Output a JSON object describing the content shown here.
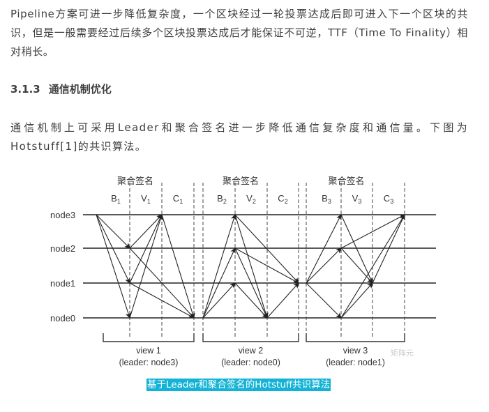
{
  "paragraph1": "Pipeline方案可进一步降低复杂度，一个区块经过一轮投票达成后即可进入下一个区块的共识，但是一般需要经过后续多个区块投票达成后才能保证不可逆，TTF（Time To Finality）相对稍长。",
  "heading": {
    "number": "3.1.3",
    "title": "通信机制优化"
  },
  "paragraph2": "通信机制上可采用Leader和聚合签名进一步降低通信复杂度和通信量。下图为Hotstuff[1]的共识算法。",
  "diagram": {
    "nodes": [
      "node0",
      "node1",
      "node2",
      "node3"
    ],
    "views": [
      {
        "label": "view 1",
        "leader": "(leader: node3)",
        "agg": "聚合签名",
        "phases": [
          [
            "B",
            "1"
          ],
          [
            "V",
            "1"
          ],
          [
            "C",
            "1"
          ]
        ],
        "edges": [
          [
            0,
            3,
            1,
            2
          ],
          [
            0,
            3,
            1,
            1
          ],
          [
            0,
            3,
            1,
            0
          ],
          [
            1,
            2,
            2,
            3
          ],
          [
            1,
            1,
            2,
            3
          ],
          [
            1,
            0,
            2,
            3
          ],
          [
            2,
            3,
            3,
            0
          ],
          [
            1,
            2,
            3,
            0
          ],
          [
            1,
            1,
            3,
            0
          ]
        ]
      },
      {
        "label": "view 2",
        "leader": "(leader: node0)",
        "agg": "聚合签名",
        "phases": [
          [
            "B",
            "2"
          ],
          [
            "V",
            "2"
          ],
          [
            "C",
            "2"
          ]
        ],
        "edges": [
          [
            0,
            0,
            1,
            3
          ],
          [
            0,
            0,
            1,
            2
          ],
          [
            0,
            0,
            1,
            1
          ],
          [
            1,
            3,
            2,
            0
          ],
          [
            1,
            2,
            2,
            0
          ],
          [
            1,
            1,
            2,
            0
          ],
          [
            2,
            0,
            3,
            1
          ],
          [
            1,
            3,
            3,
            1
          ],
          [
            1,
            2,
            3,
            1
          ]
        ]
      },
      {
        "label": "view 3",
        "leader": "(leader: node1)",
        "agg": "聚合签名",
        "phases": [
          [
            "B",
            "3"
          ],
          [
            "V",
            "3"
          ],
          [
            "C",
            "3"
          ]
        ],
        "edges": [
          [
            0,
            1,
            1,
            3
          ],
          [
            0,
            1,
            1,
            2
          ],
          [
            0,
            1,
            1,
            0
          ],
          [
            1,
            3,
            2,
            1
          ],
          [
            1,
            2,
            2,
            1
          ],
          [
            1,
            0,
            2,
            1
          ],
          [
            2,
            1,
            3,
            3
          ],
          [
            1,
            2,
            3,
            3
          ],
          [
            1,
            0,
            3,
            3
          ]
        ]
      }
    ],
    "watermark": "矩阵元"
  },
  "caption": "基于Leader和聚合签名的Hotstuff共识算法",
  "colors": {
    "text": "#3e3e3e",
    "caption_bg": "#12b3d6"
  }
}
